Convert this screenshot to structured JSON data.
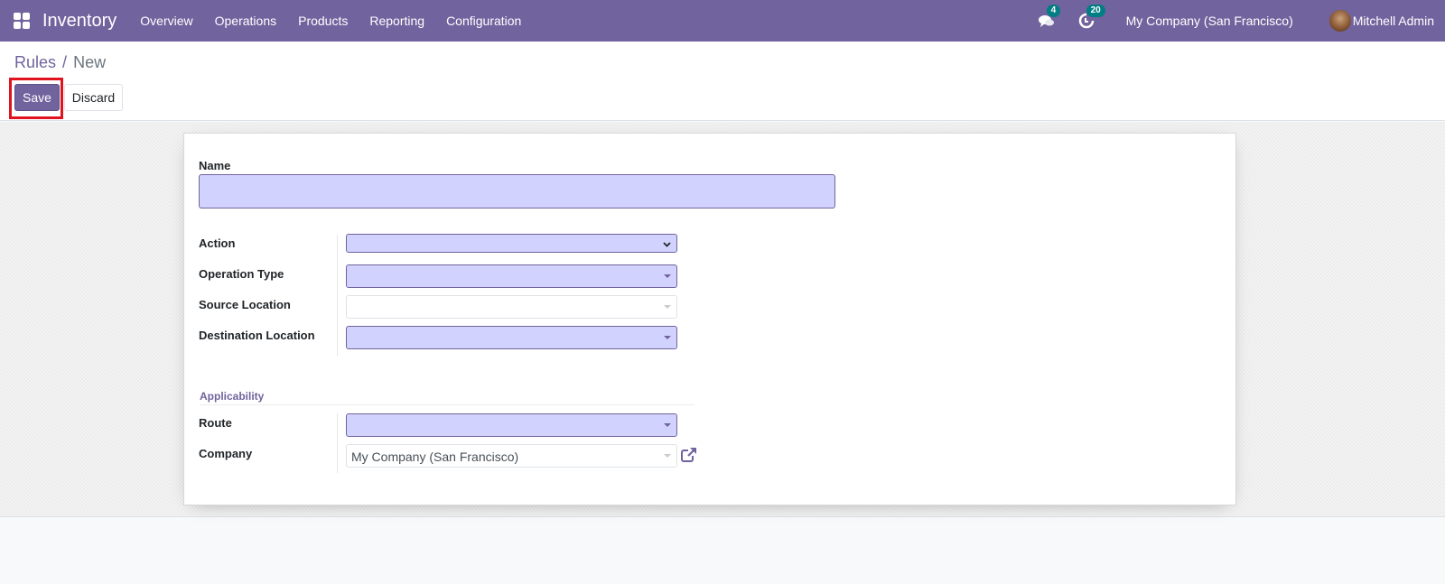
{
  "navbar": {
    "app_title": "Inventory",
    "menu": [
      "Overview",
      "Operations",
      "Products",
      "Reporting",
      "Configuration"
    ],
    "messages_count": "4",
    "activities_count": "20",
    "company": "My Company (San Francisco)",
    "user": "Mitchell Admin"
  },
  "breadcrumb": {
    "parent": "Rules",
    "separator": "/",
    "current": "New"
  },
  "buttons": {
    "save": "Save",
    "discard": "Discard"
  },
  "form": {
    "name_label": "Name",
    "name_value": "",
    "fields": {
      "action": {
        "label": "Action",
        "value": ""
      },
      "operation_type": {
        "label": "Operation Type",
        "value": ""
      },
      "source_location": {
        "label": "Source Location",
        "value": ""
      },
      "destination_location": {
        "label": "Destination Location",
        "value": ""
      }
    },
    "applicability": {
      "title": "Applicability",
      "route": {
        "label": "Route",
        "value": ""
      },
      "company": {
        "label": "Company",
        "value": "My Company (San Francisco)"
      }
    }
  },
  "colors": {
    "brand": "#71639e",
    "required_field_bg": "#d2d2ff",
    "highlight": "#e0141e",
    "badge": "#017e84"
  }
}
